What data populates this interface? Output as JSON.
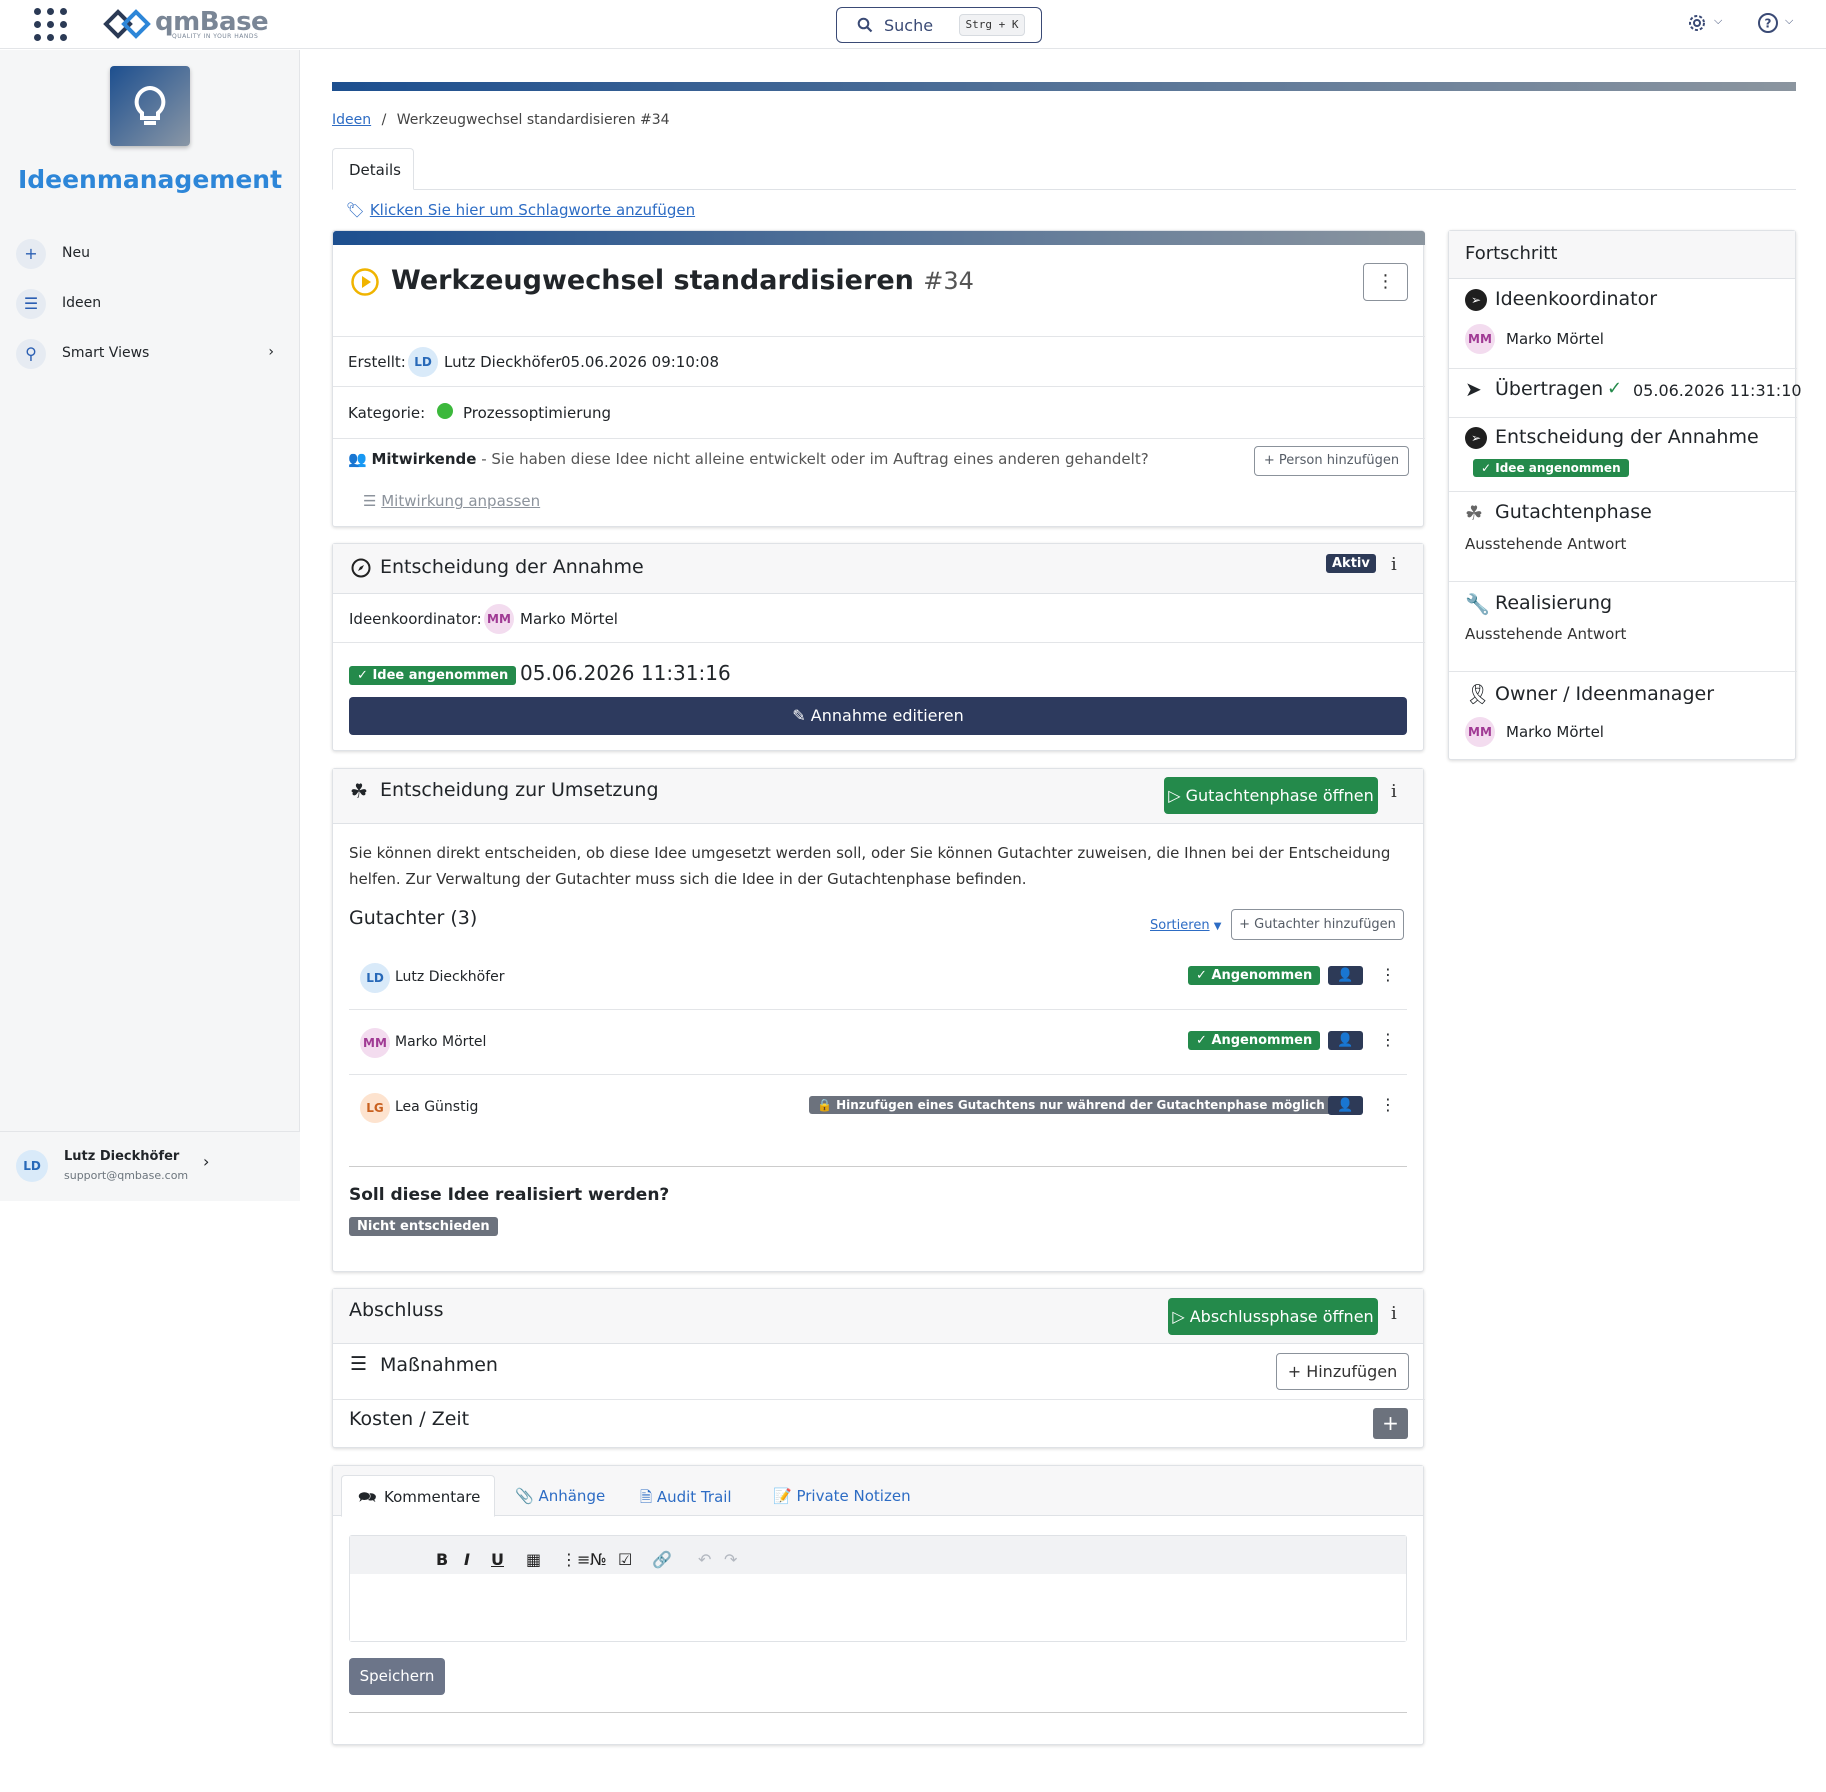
{
  "topbar": {
    "logo_text": "qmBase",
    "logo_tagline": "QUALITY IN YOUR HANDS",
    "search_label": "Suche",
    "search_shortcut": "Strg + K",
    "apps_icon": "apps-grid-icon",
    "settings_icon": "gear-icon",
    "help_icon": "question-circle-icon"
  },
  "sidebar": {
    "app_title": "Ideenmanagement",
    "items": [
      {
        "label": "Neu",
        "icon": "plus-icon"
      },
      {
        "label": "Ideen",
        "icon": "list-icon"
      },
      {
        "label": "Smart Views",
        "icon": "search-icon"
      }
    ],
    "user": {
      "initials": "LD",
      "name": "Lutz Dieckhöfer",
      "email": "support@qmbase.com"
    }
  },
  "breadcrumb": {
    "parent": "Ideen",
    "separator": "/",
    "current": "Werkzeugwechsel standardisieren #34"
  },
  "tabs": {
    "details": "Details"
  },
  "tags_link": "Klicken Sie hier um Schlagworte anzufügen",
  "idea": {
    "title": "Werkzeugwechsel standardisieren",
    "number": "#34",
    "created_label": "Erstellt:",
    "created_by_initials": "LD",
    "created_by": "Lutz Dieckhöfer",
    "created_at": "05.06.2026 09:10:08",
    "category_label": "Kategorie:",
    "category": "Prozessoptimierung",
    "category_color": "#3cb83c",
    "contributors_label": "Mitwirkende",
    "contributors_text": " - Sie haben diese Idee nicht alleine entwickelt oder im Auftrag eines anderen gehandelt?",
    "add_person": "Person hinzufügen",
    "adjust_contribution": "Mitwirkung anpassen"
  },
  "acceptance": {
    "title": "Entscheidung der Annahme",
    "status_badge": "Aktiv",
    "coordinator_label": "Ideenkoordinator:",
    "coordinator_initials": "MM",
    "coordinator": "Marko Mörtel",
    "decision_badge": "Idee angenommen",
    "decision_time": "05.06.2026 11:31:16",
    "edit_button": "Annahme editieren"
  },
  "implementation": {
    "title": "Entscheidung zur Umsetzung",
    "open_button": "Gutachtenphase öffnen",
    "description": "Sie können direkt entscheiden, ob diese Idee umgesetzt werden soll, oder Sie können Gutachter zuweisen, die Ihnen bei der Entscheidung helfen. Zur Verwaltung der Gutachter muss sich die Idee in der Gutachtenphase befinden.",
    "reviewers_title": "Gutachter (3)",
    "sort_label": "Sortieren",
    "add_reviewer": "Gutachter hinzufügen",
    "reviewers": [
      {
        "initials": "LD",
        "name": "Lutz Dieckhöfer",
        "status": "Angenommen"
      },
      {
        "initials": "MM",
        "name": "Marko Mörtel",
        "status": "Angenommen"
      },
      {
        "initials": "LG",
        "name": "Lea Günstig",
        "status": "Hinzufügen eines Gutachtens nur während der Gutachtenphase möglich"
      }
    ],
    "question": "Soll diese Idee realisiert werden?",
    "question_badge": "Nicht entschieden"
  },
  "closing": {
    "title": "Abschluss",
    "open_button": "Abschlussphase öffnen",
    "measures_title": "Maßnahmen",
    "measures_add": "Hinzufügen",
    "cost_title": "Kosten / Zeit",
    "cost_add": "+"
  },
  "comments": {
    "tabs": [
      "Kommentare",
      "Anhänge",
      "Audit Trail",
      "Private Notizen"
    ],
    "save_button": "Speichern"
  },
  "progress": {
    "title": "Fortschritt",
    "steps": [
      {
        "title": "Ideenkoordinator",
        "person_initials": "MM",
        "person": "Marko Mörtel",
        "icon": "compass-icon"
      },
      {
        "title": "Übertragen",
        "time": "05.06.2026 11:31:10",
        "icon": "paper-plane-icon"
      },
      {
        "title": "Entscheidung der Annahme",
        "badge": "Idee angenommen",
        "icon": "compass-icon"
      },
      {
        "title": "Gutachtenphase",
        "sub": "Ausstehende Antwort",
        "icon": "cubes-icon"
      },
      {
        "title": "Realisierung",
        "sub": "Ausstehende Antwort",
        "icon": "wrench-icon"
      },
      {
        "title": "Owner / Ideenmanager",
        "person_initials": "MM",
        "person": "Marko Mörtel",
        "icon": "award-icon"
      }
    ]
  },
  "colors": {
    "brand_blue": "#2d86d8",
    "primary_dark": "#2d3a57",
    "success": "#248a4b",
    "link": "#2d6cc4"
  }
}
